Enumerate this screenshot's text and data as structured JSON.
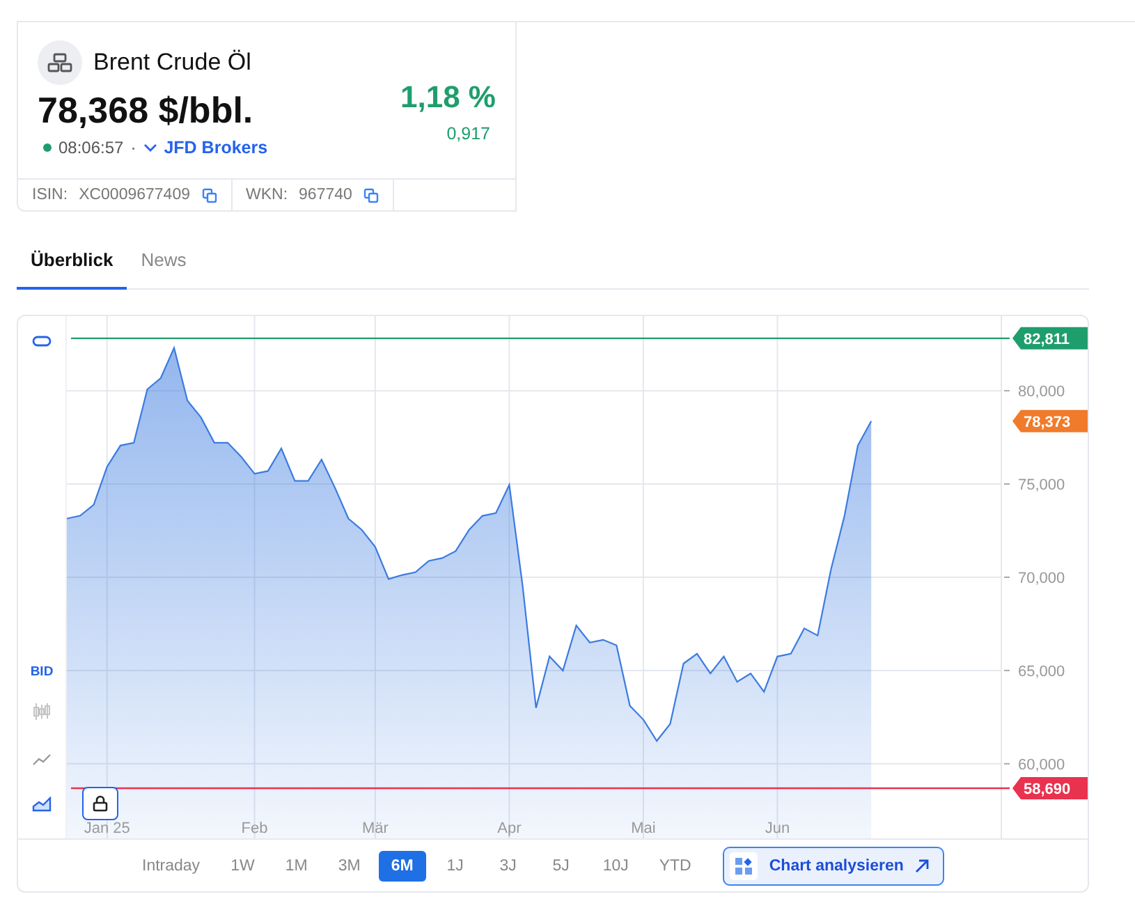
{
  "instrument": {
    "name": "Brent Crude Öl",
    "price": "78,368 $/bbl.",
    "change_percent": "1,18 %",
    "change_abs": "0,917",
    "live": true,
    "time": "08:06:57",
    "separator": "·",
    "source": "JFD Brokers"
  },
  "identifiers": [
    {
      "label": "ISIN:",
      "value": "XC0009677409"
    },
    {
      "label": "WKN:",
      "value": "967740"
    }
  ],
  "tabs": [
    {
      "label": "Überblick",
      "selected": true
    },
    {
      "label": "News",
      "selected": false
    }
  ],
  "chart": {
    "toolbar": [
      {
        "kind": "shape"
      },
      {
        "kind": "series"
      },
      {
        "kind": "candles",
        "selected": false
      },
      {
        "kind": "line",
        "selected": false
      },
      {
        "kind": "area",
        "selected": true
      }
    ],
    "chart_data": {
      "type": "area",
      "categories": [
        null,
        null,
        null,
        "Jan 25",
        null,
        null,
        null,
        null,
        null,
        null,
        null,
        null,
        null,
        null,
        "Feb",
        null,
        null,
        null,
        null,
        null,
        null,
        null,
        null,
        "Mär",
        null,
        null,
        null,
        null,
        null,
        null,
        null,
        null,
        null,
        "Apr",
        null,
        null,
        null,
        null,
        null,
        null,
        null,
        null,
        null,
        "Mai",
        null,
        null,
        null,
        null,
        null,
        null,
        null,
        null,
        null,
        "Jun",
        null,
        null,
        null,
        null,
        null,
        null,
        null
      ],
      "series": [
        {
          "name": "BID",
          "color": "#3b7be0",
          "values": [
            73.14,
            73.3,
            73.89,
            75.93,
            77.06,
            77.21,
            80.08,
            80.68,
            82.3,
            79.47,
            78.57,
            77.21,
            77.21,
            76.46,
            75.55,
            75.7,
            76.91,
            75.17,
            75.17,
            76.31,
            74.8,
            73.14,
            72.54,
            71.63,
            69.9,
            70.12,
            70.27,
            70.88,
            71.03,
            71.4,
            72.54,
            73.29,
            73.44,
            74.95,
            69.52,
            63.0,
            65.75,
            65.0,
            67.41,
            66.5,
            66.65,
            66.35,
            63.11,
            62.36,
            61.23,
            62.13,
            65.37,
            65.9,
            64.84,
            65.75,
            64.39,
            64.84,
            63.86,
            65.75,
            65.9,
            67.26,
            66.88,
            70.42,
            73.29,
            77.06,
            78.37
          ]
        }
      ],
      "ylim": [
        56,
        84
      ],
      "yticks": [
        {
          "value": 60,
          "label": "60,000"
        },
        {
          "value": 65,
          "label": "65,000"
        },
        {
          "value": 70,
          "label": "70,000"
        },
        {
          "value": 75,
          "label": "75,000"
        },
        {
          "value": 80,
          "label": "80,000"
        }
      ],
      "grid": true,
      "ref_lines": [
        {
          "axis": "y",
          "value": 82.811,
          "label": "82,811",
          "color": "#1f9e6d"
        },
        {
          "axis": "y",
          "value": 58.69,
          "label": "58,690",
          "color": "#e8324f"
        }
      ]
    },
    "last_price": {
      "label": "78,373",
      "color": "#f07b2a"
    }
  },
  "ranges": [
    {
      "label": "Intraday",
      "selected": false
    },
    {
      "label": "1W",
      "selected": false
    },
    {
      "label": "1M",
      "selected": false
    },
    {
      "label": "3M",
      "selected": false
    },
    {
      "label": "6M",
      "selected": true
    },
    {
      "label": "1J",
      "selected": false
    },
    {
      "label": "3J",
      "selected": false
    },
    {
      "label": "5J",
      "selected": false
    },
    {
      "label": "10J",
      "selected": false
    },
    {
      "label": "YTD",
      "selected": false
    }
  ],
  "analyze_button": "Chart analysieren"
}
